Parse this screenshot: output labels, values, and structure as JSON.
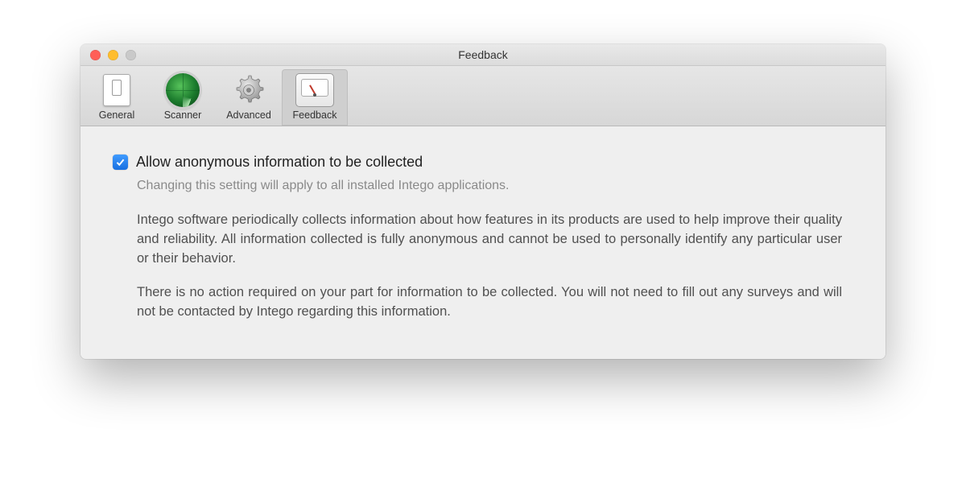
{
  "window": {
    "title": "Feedback"
  },
  "tabs": {
    "general": {
      "label": "General"
    },
    "scanner": {
      "label": "Scanner"
    },
    "advanced": {
      "label": "Advanced"
    },
    "feedback": {
      "label": "Feedback"
    }
  },
  "pane": {
    "checkbox_label": "Allow anonymous information to be collected",
    "checkbox_checked": true,
    "subnote": "Changing this setting will apply to all installed Intego applications.",
    "para1": "Intego software periodically collects information about how features in its products are used to help improve their quality and reliability. All information collected is fully anonymous and cannot be used to personally identify any particular user or their behavior.",
    "para2": "There is no action required on your part for information to be collected. You will not need to fill out any surveys and will not be contacted by Intego regarding this information."
  }
}
